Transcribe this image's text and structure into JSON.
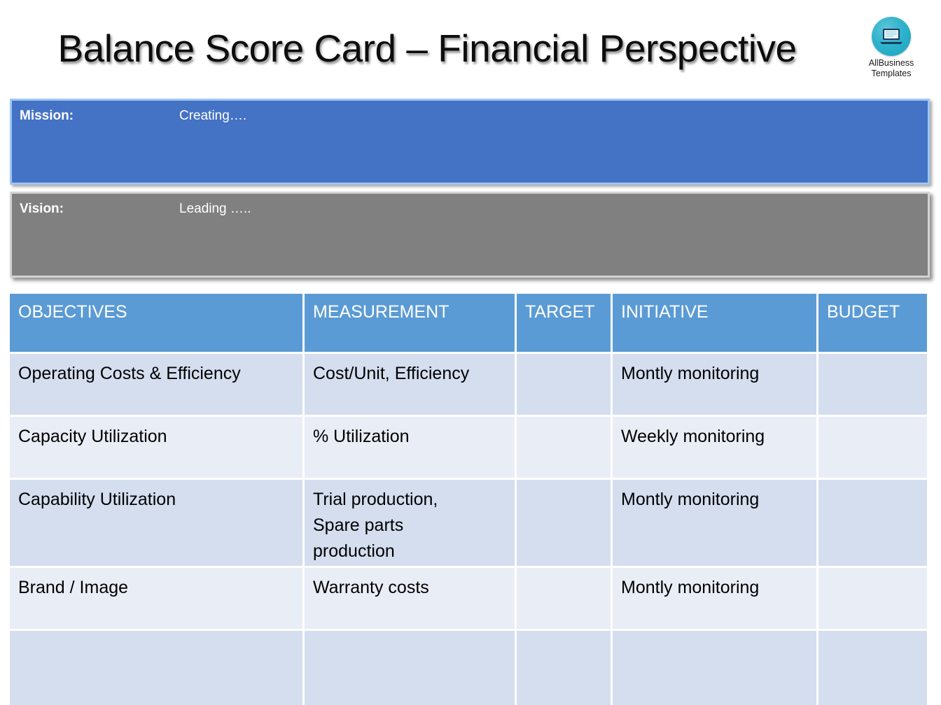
{
  "title": "Balance Score Card – Financial Perspective",
  "logo": {
    "icon": "laptop-icon",
    "line1": "AllBusiness",
    "line2": "Templates",
    "circle_color": "#2fb3cc"
  },
  "mission": {
    "label": "Mission:",
    "value": "Creating….",
    "background": "#4472C4",
    "border": "#9fc6f5"
  },
  "vision": {
    "label": "Vision:",
    "value": "Leading …..",
    "background": "#808080",
    "border": "#d3d3d3"
  },
  "table": {
    "header_background": "#5B9BD5",
    "row_dark": "#D4DEEF",
    "row_light": "#E9EDF6",
    "columns": [
      "OBJECTIVES",
      "MEASUREMENT",
      "TARGET",
      "INITIATIVE",
      "BUDGET"
    ],
    "rows": [
      {
        "objectives": "Operating Costs & Efficiency",
        "measurement": "Cost/Unit, Efficiency",
        "target": "",
        "initiative": "Montly monitoring",
        "budget": ""
      },
      {
        "objectives": "Capacity Utilization",
        "measurement": "% Utilization",
        "target": "",
        "initiative": "Weekly monitoring",
        "budget": ""
      },
      {
        "objectives": "Capability Utilization",
        "measurement": "Trial production,\nSpare parts\nproduction",
        "target": "",
        "initiative": "Montly monitoring",
        "budget": ""
      },
      {
        "objectives": "Brand / Image",
        "measurement": "Warranty costs",
        "target": "",
        "initiative": "Montly monitoring",
        "budget": ""
      },
      {
        "objectives": "",
        "measurement": "",
        "target": "",
        "initiative": "",
        "budget": ""
      }
    ]
  }
}
